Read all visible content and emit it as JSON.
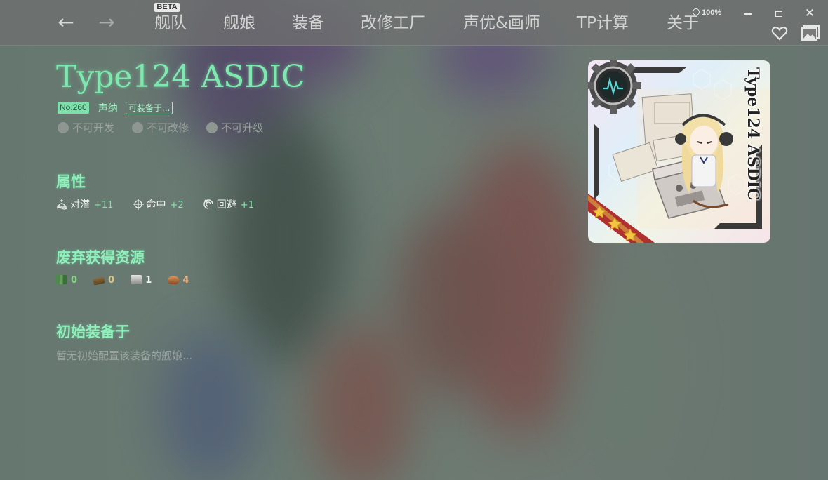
{
  "nav": {
    "back_arrow": "←",
    "forward_arrow": "→",
    "beta_badge": "BETA",
    "items": [
      "舰队",
      "舰娘",
      "装备",
      "改修工厂",
      "声优&画师",
      "TP计算",
      "关于"
    ],
    "zoom_level": "100%"
  },
  "window": {
    "minimize_icon": "minimize-icon",
    "maximize_icon": "maximize-icon",
    "close_symbol": "✕",
    "close_icon": "close-icon"
  },
  "toolbar": {
    "favorite_icon": "heart-icon",
    "gallery_icon": "gallery-icon"
  },
  "equipment": {
    "name": "Type124 ASDIC",
    "number": "No.260",
    "type": "声纳",
    "equippable_link": "可装备于...",
    "flags": [
      "不可开发",
      "不可改修",
      "不可升级"
    ],
    "card_label": "Type124 ASDIC",
    "card_rarity_stars": 3
  },
  "sections": {
    "attributes_title": "属性",
    "scrap_title": "废弃获得资源",
    "initial_title": "初始装备于",
    "initial_empty": "暂无初始配置该装备的舰娘..."
  },
  "stats": [
    {
      "icon": "asw-icon",
      "label": "对潜",
      "value": "+11"
    },
    {
      "icon": "accuracy-icon",
      "label": "命中",
      "value": "+2"
    },
    {
      "icon": "evasion-icon",
      "label": "回避",
      "value": "+1"
    }
  ],
  "resources": [
    {
      "icon": "fuel-icon",
      "value": "0"
    },
    {
      "icon": "ammo-icon",
      "value": "0"
    },
    {
      "icon": "steel-icon",
      "value": "1"
    },
    {
      "icon": "bauxite-icon",
      "value": "4"
    }
  ],
  "colors": {
    "accent": "#7fe8b0",
    "stat_value": "#7fe6a8",
    "badge_bg": "#7ddfaa"
  }
}
